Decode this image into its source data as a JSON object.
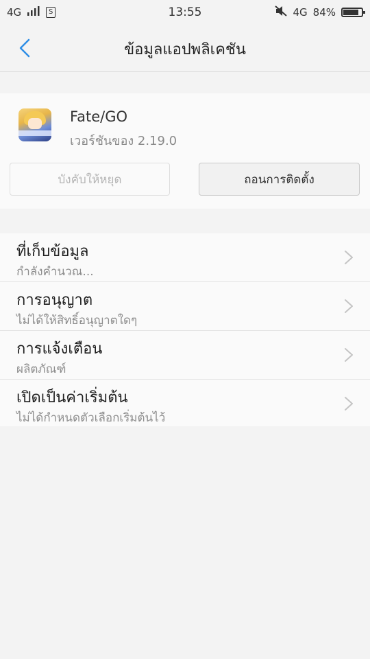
{
  "status_bar": {
    "network": "4G",
    "signal_bars": "ıııl",
    "sim_label": "S",
    "time": "13:55",
    "network_right": "4G",
    "battery": "84%",
    "battery_level": 0.84
  },
  "header": {
    "title": "ข้อมูลแอปพลิเคชัน"
  },
  "app": {
    "name": "Fate/GO",
    "version": "เวอร์ชันของ 2.19.0"
  },
  "buttons": {
    "force_stop": "บังคับให้หยุด",
    "uninstall": "ถอนการติดตั้ง"
  },
  "settings": [
    {
      "title": "ที่เก็บข้อมูล",
      "subtitle": "กำลังคำนวณ..."
    },
    {
      "title": "การอนุญาต",
      "subtitle": "ไม่ได้ให้สิทธิ์อนุญาตใดๆ"
    },
    {
      "title": "การแจ้งเตือน",
      "subtitle": "ผลิตภัณฑ์"
    },
    {
      "title": "เปิดเป็นค่าเริ่มต้น",
      "subtitle": "ไม่ได้กำหนดตัวเลือกเริ่มต้นไว้"
    }
  ],
  "colors": {
    "accent": "#2f8ee6",
    "background": "#f3f3f3"
  }
}
